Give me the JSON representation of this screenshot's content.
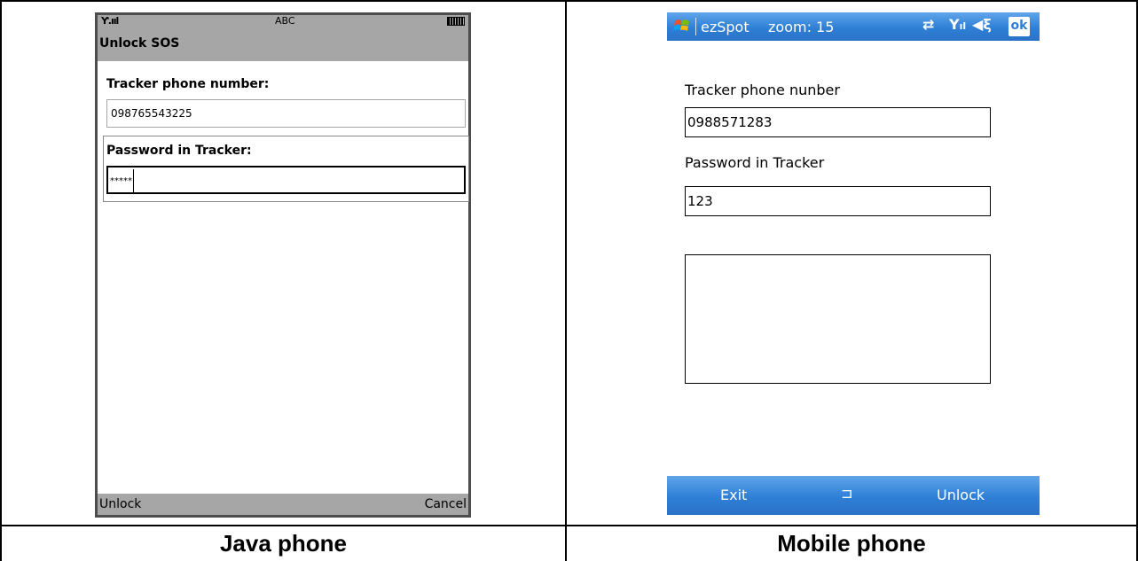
{
  "captions": {
    "left": "Java phone",
    "right": "Mobile phone"
  },
  "java_phone": {
    "status": {
      "signal": "Ƴ.ııl",
      "input_mode": "ABC",
      "battery_icon": "battery-icon"
    },
    "title": "Unlock SOS",
    "phone_label": "Tracker phone number:",
    "phone_value": "098765543225",
    "password_label": "Password in Tracker:",
    "password_value": "*****",
    "softkeys": {
      "left": "Unlock",
      "right": "Cancel"
    }
  },
  "mobile_phone": {
    "top_bar": {
      "start_icon": "windows-start-icon",
      "app_name": "ezSpot",
      "zoom": "zoom: 15",
      "ok": "ok"
    },
    "phone_label": "Tracker phone nunber",
    "phone_value": "0988571283",
    "password_label": "Password in Tracker",
    "password_value": "123",
    "message_area": "",
    "bottom_bar": {
      "left": "Exit",
      "keyboard_icon": "keyboard-icon",
      "right": "Unlock"
    },
    "colors": {
      "bar": "#2f7fd6"
    }
  }
}
